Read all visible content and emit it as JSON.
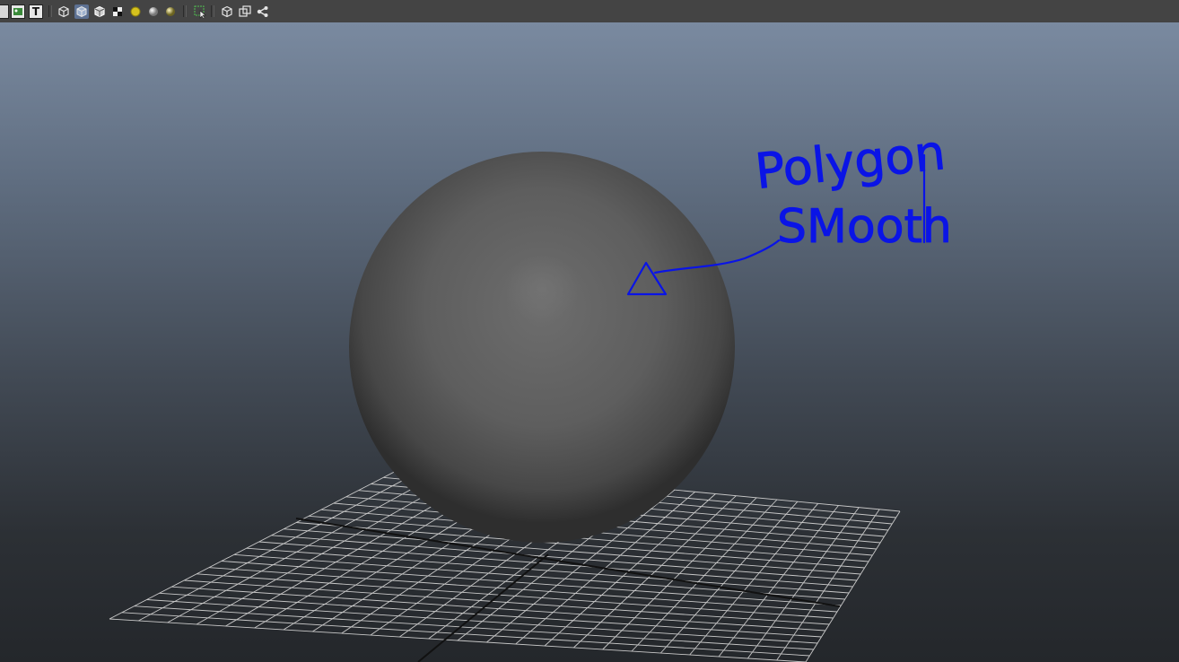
{
  "toolbar": {
    "icons": [
      "camera-attributes-icon",
      "image-plane-icon",
      "text-t-icon",
      "wireframe-cube-icon",
      "smooth-shaded-cube-icon",
      "wireframe-on-shaded-cube-icon",
      "textured-checker-icon",
      "use-all-lights-icon",
      "default-material-icon",
      "shadows-icon",
      "select-camera-icon",
      "isolate-select-icon",
      "xray-icon",
      "xray-joints-icon"
    ],
    "text_button_label": "T"
  },
  "viewport": {
    "object": "polygon-sphere",
    "grid": true,
    "background_top": "#7a8aa0",
    "background_bottom": "#24272b"
  },
  "annotation": {
    "color": "#0a14e6",
    "line1": "Polygon",
    "line2": "SMooth"
  }
}
